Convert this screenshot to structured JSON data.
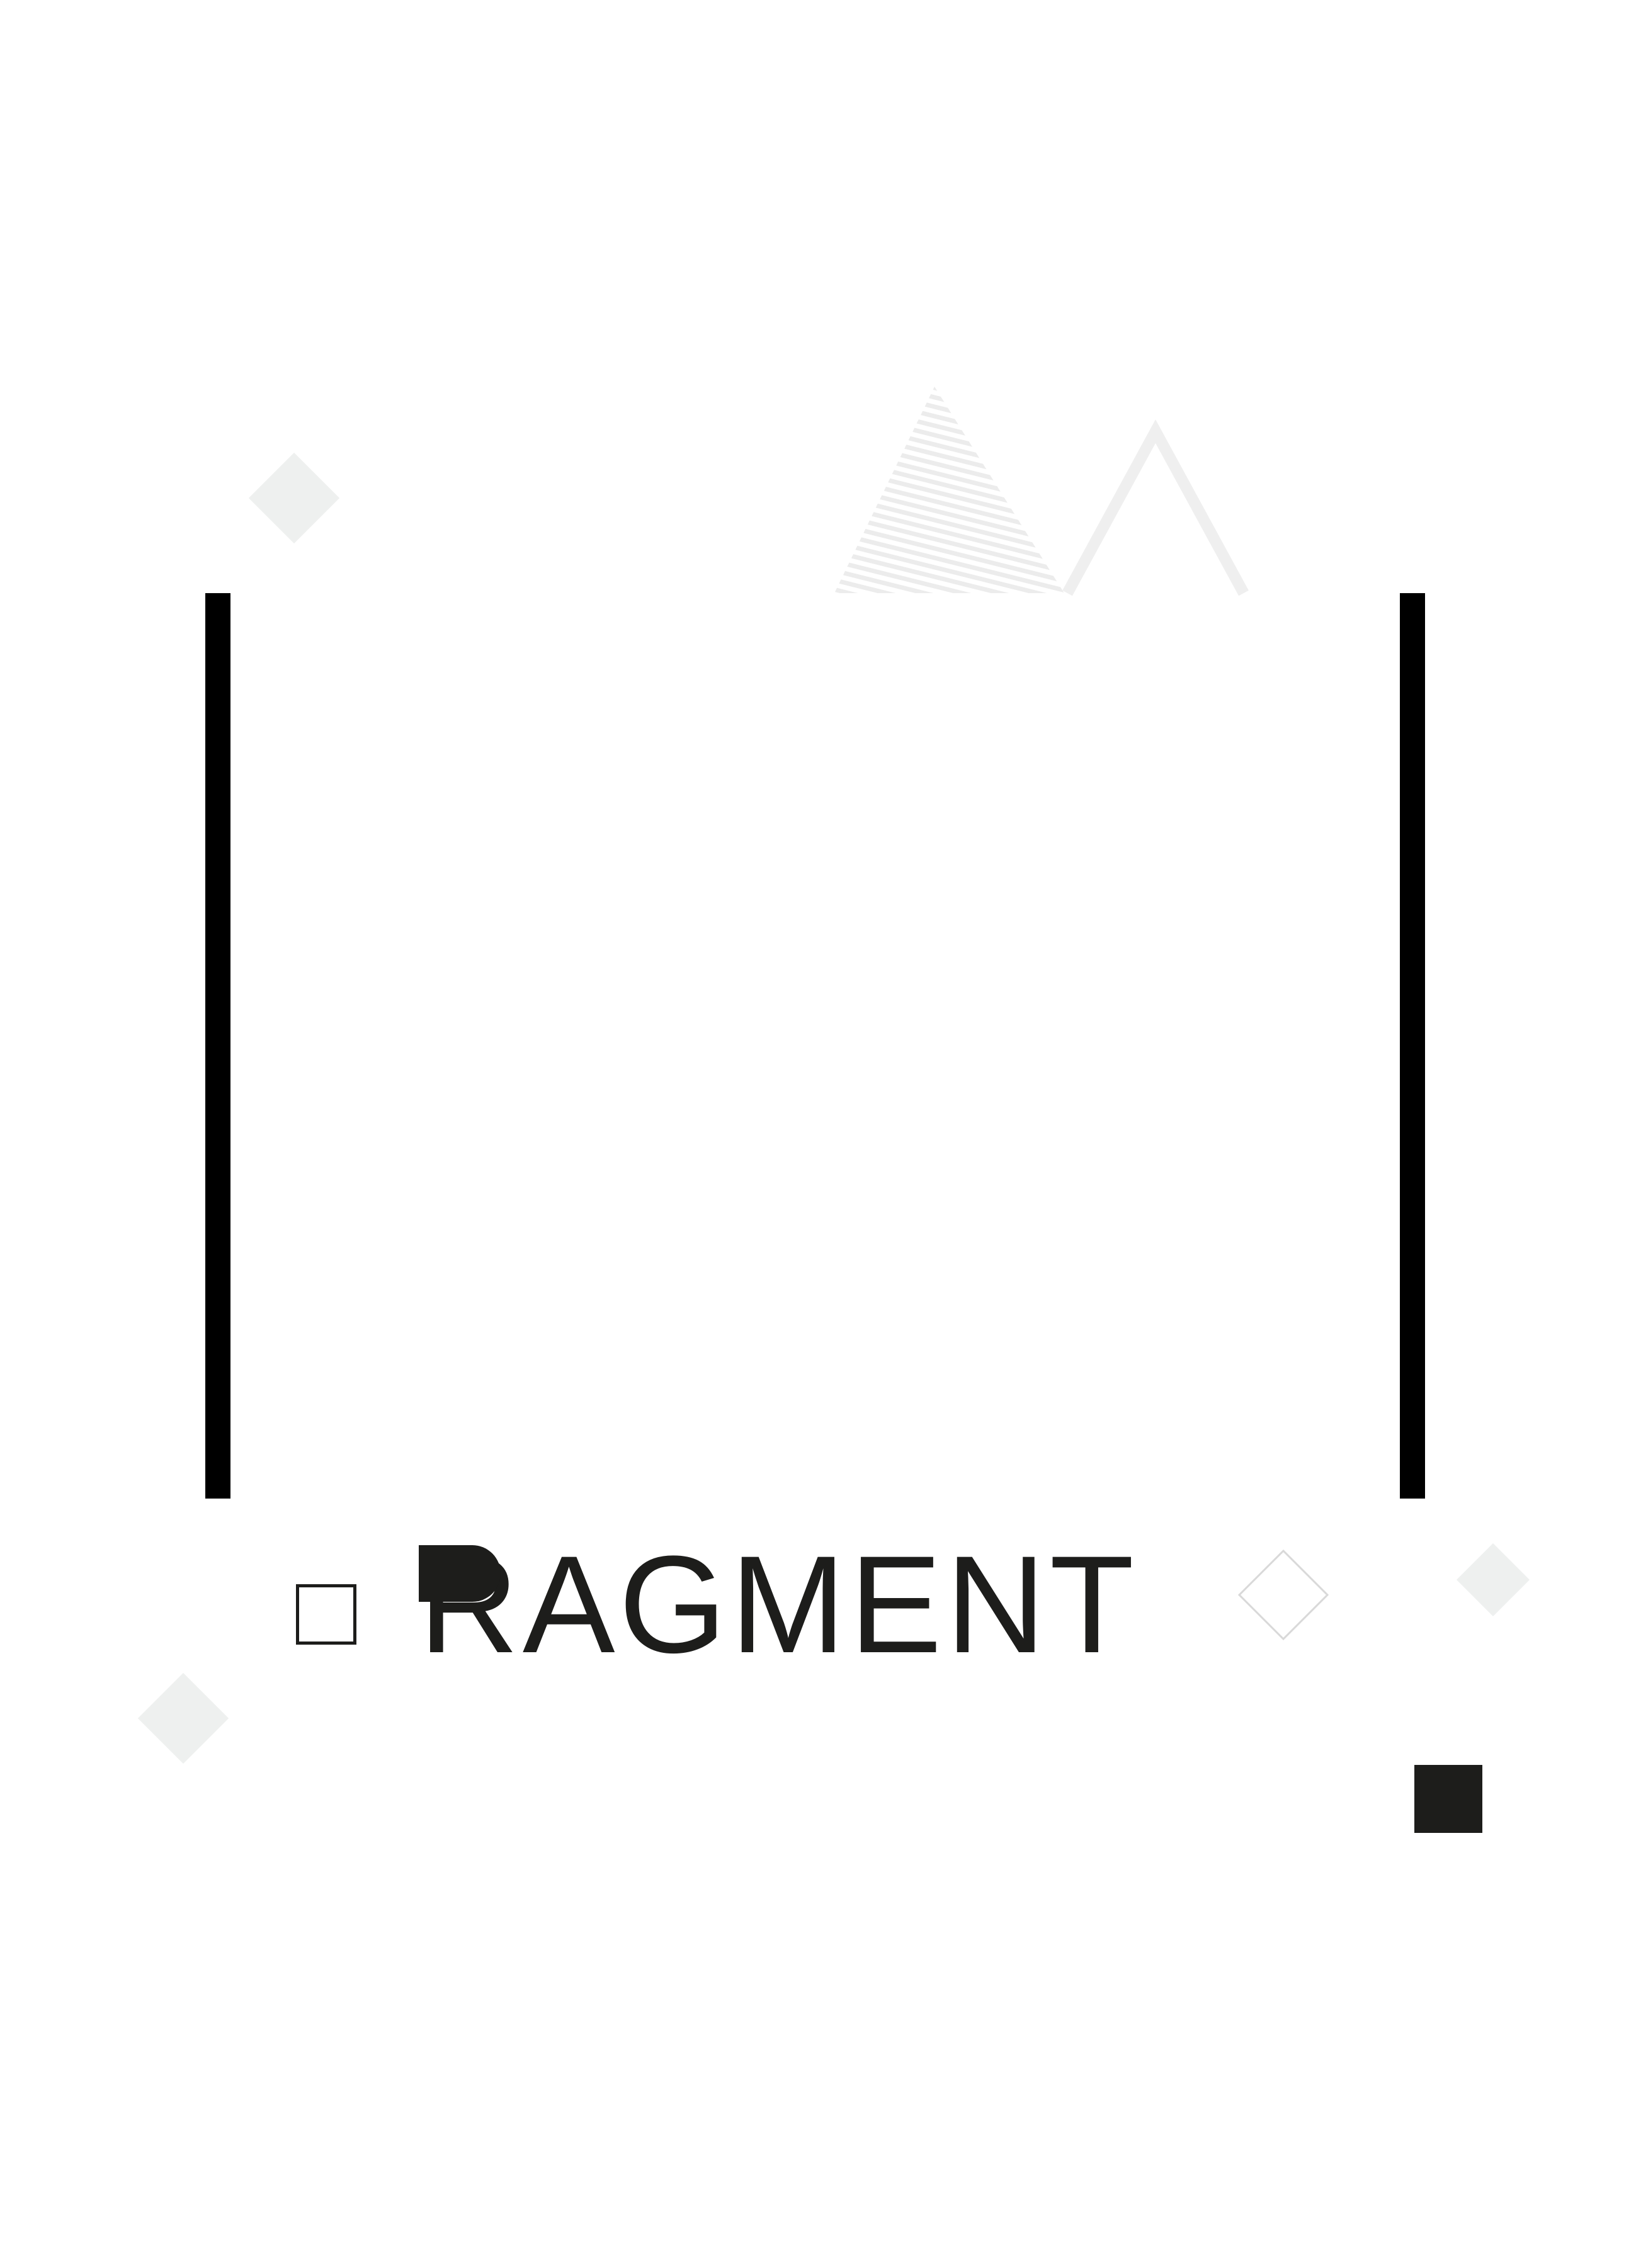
{
  "logo": {
    "wordmark": "RAGMENT"
  },
  "colors": {
    "ink": "#1d1d1b",
    "bar": "#000000",
    "light_shape": "#eef0ef",
    "outline_shape": "#d9d9d9",
    "background": "#ffffff"
  }
}
